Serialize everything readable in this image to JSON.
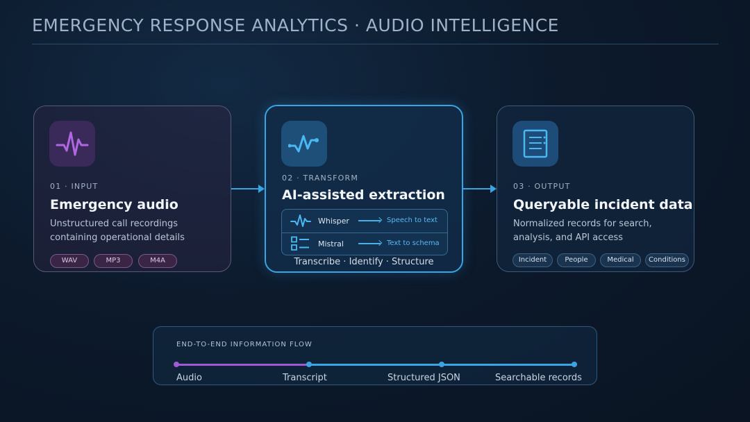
{
  "header": {
    "title": "EMERGENCY RESPONSE ANALYTICS · AUDIO INTELLIGENCE"
  },
  "cards": {
    "input": {
      "step": "01 · INPUT",
      "title": "Emergency audio",
      "description": "Unstructured call recordings containing operational details",
      "icon": "waveform-icon",
      "formats": [
        "WAV",
        "MP3",
        "M4A"
      ]
    },
    "transform": {
      "step": "02 · TRANSFORM",
      "title": "AI-assisted extraction",
      "icon": "pulse-icon",
      "models": [
        {
          "name": "Whisper",
          "result": "Speech to text",
          "icon": "waveform-icon"
        },
        {
          "name": "Mistral",
          "result": "Text to schema",
          "icon": "schema-icon"
        }
      ],
      "caption": "Transcribe · Identify · Structure"
    },
    "output": {
      "step": "03 · OUTPUT",
      "title": "Queryable incident data",
      "description": "Normalized records for search, analysis, and API access",
      "icon": "document-icon",
      "tags": [
        "Incident",
        "People",
        "Medical",
        "Conditions"
      ]
    }
  },
  "flow": {
    "title": "END-TO-END INFORMATION FLOW",
    "stages": [
      "Audio",
      "Transcript",
      "Structured JSON",
      "Searchable records"
    ]
  },
  "colors": {
    "accent_blue": "#3aa4e4",
    "accent_purple": "#a15ad6"
  }
}
